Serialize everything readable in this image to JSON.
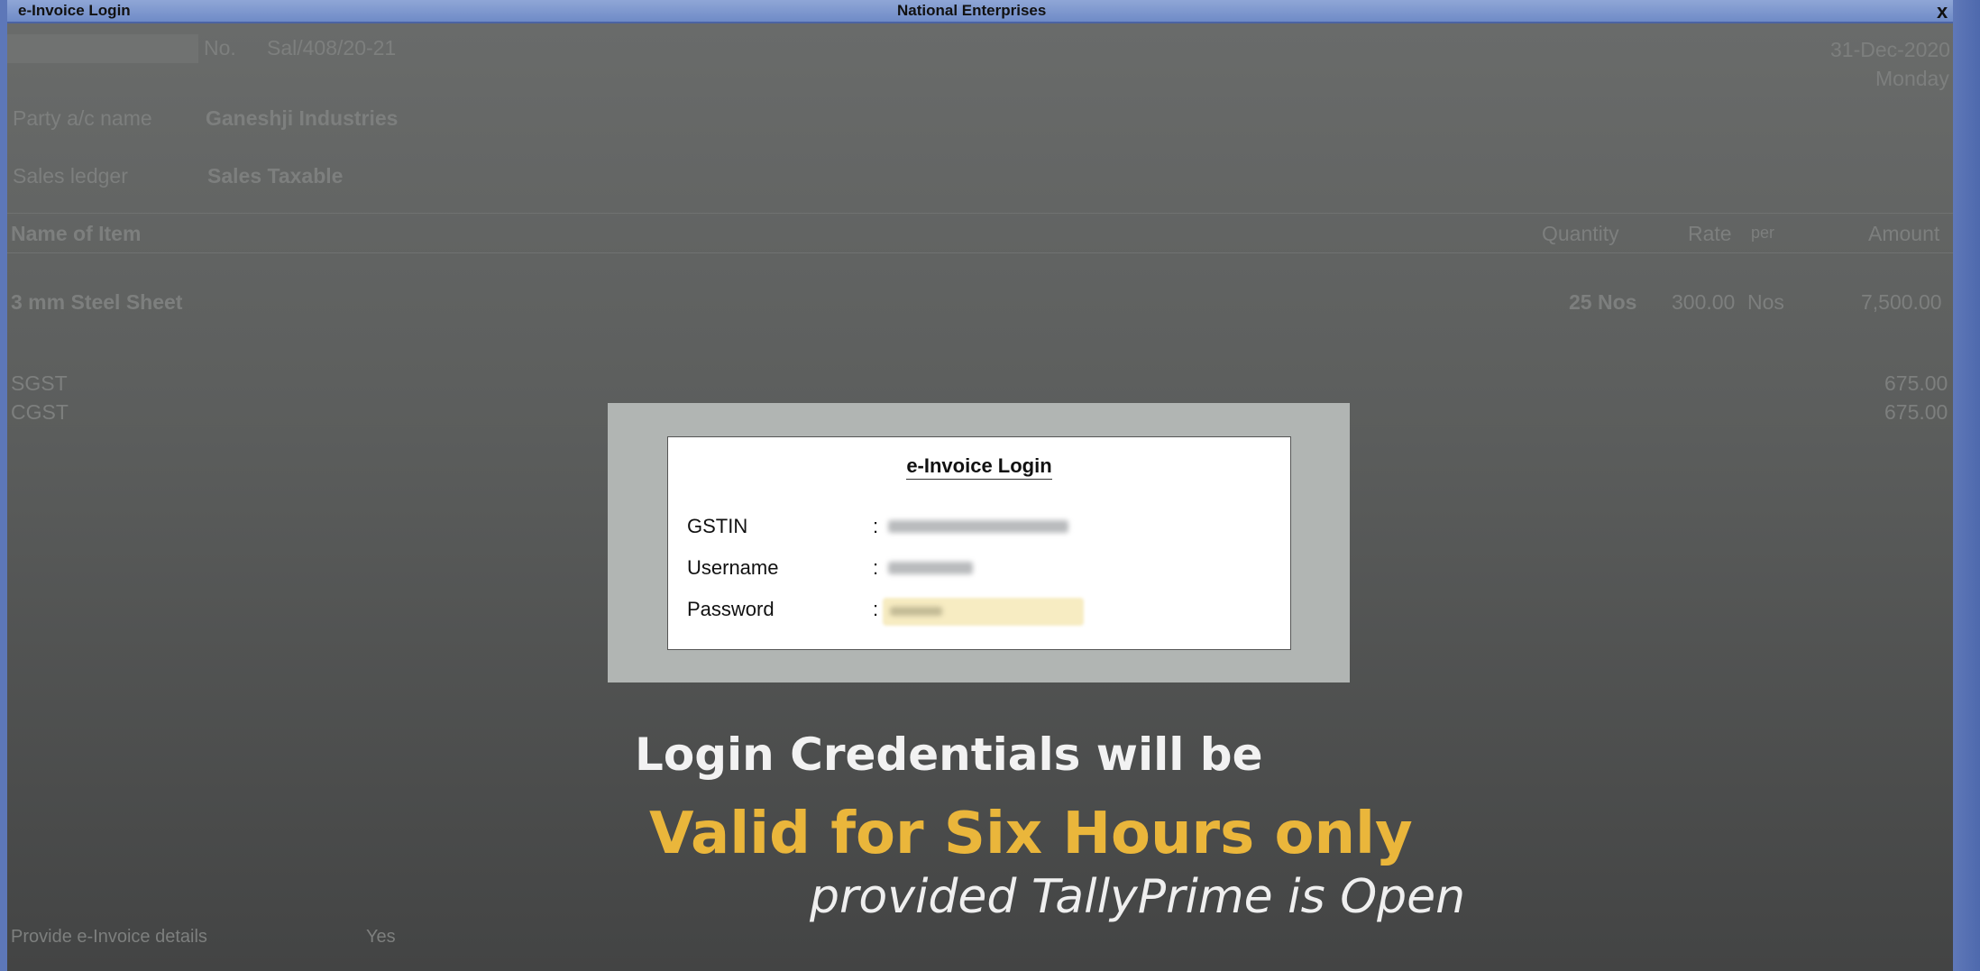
{
  "titlebar": {
    "left_title": "e-Invoice Login",
    "center_title": "National Enterprises",
    "close_glyph": "x"
  },
  "voucher": {
    "no_label": "No.",
    "no_value": "Sal/408/20-21",
    "date": "31-Dec-2020",
    "day": "Monday",
    "party_label": "Party a/c name",
    "party_value": "Ganeshji Industries",
    "sales_ledger_label": "Sales ledger",
    "sales_ledger_value": "Sales Taxable",
    "columns": {
      "item": "Name of Item",
      "quantity": "Quantity",
      "rate": "Rate",
      "per": "per",
      "amount": "Amount"
    },
    "item_row": {
      "name": "3 mm Steel Sheet",
      "quantity": "25 Nos",
      "rate": "300.00",
      "per": "Nos",
      "amount": "7,500.00"
    },
    "taxes": [
      {
        "name": "SGST",
        "amount": "675.00"
      },
      {
        "name": "CGST",
        "amount": "675.00"
      }
    ],
    "provide_label": "Provide e-Invoice details",
    "provide_value": "Yes"
  },
  "dialog": {
    "title": "e-Invoice Login",
    "fields": [
      {
        "label": "GSTIN",
        "colon": ":"
      },
      {
        "label": "Username",
        "colon": ":"
      },
      {
        "label": "Password",
        "colon": ":"
      }
    ]
  },
  "captions": {
    "line1": "Login Credentials will be",
    "line2": "Valid for Six Hours only",
    "line3": "provided TallyPrime is Open"
  },
  "colors": {
    "caption_accent": "#eab63b",
    "titlebar": "#7f97cd"
  }
}
